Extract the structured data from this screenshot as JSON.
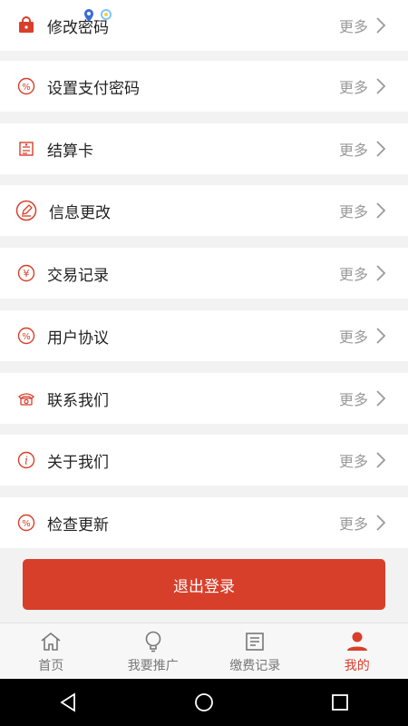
{
  "colors": {
    "accent": "#d83f2a",
    "background": "#f2f2f2",
    "more_text": "#9a9a9a"
  },
  "menu": {
    "items": [
      {
        "label": "修改密码",
        "more": "更多",
        "icon": "shopping-bag-icon"
      },
      {
        "label": "设置支付密码",
        "more": "更多",
        "icon": "percent-circle-icon"
      },
      {
        "label": "结算卡",
        "more": "更多",
        "icon": "card-icon"
      },
      {
        "label": "信息更改",
        "more": "更多",
        "icon": "edit-circle-icon"
      },
      {
        "label": "交易记录",
        "more": "更多",
        "icon": "yen-circle-icon"
      },
      {
        "label": "用户协议",
        "more": "更多",
        "icon": "percent-circle-icon"
      },
      {
        "label": "联系我们",
        "more": "更多",
        "icon": "telephone-icon"
      },
      {
        "label": "关于我们",
        "more": "更多",
        "icon": "info-circle-icon"
      },
      {
        "label": "检查更新",
        "more": "更多",
        "icon": "percent-circle-icon"
      }
    ]
  },
  "logout": {
    "label": "退出登录"
  },
  "tabbar": {
    "tabs": [
      {
        "label": "首页",
        "icon": "home-icon",
        "active": false
      },
      {
        "label": "我要推广",
        "icon": "lightbulb-icon",
        "active": false
      },
      {
        "label": "缴费记录",
        "icon": "notepad-icon",
        "active": false
      },
      {
        "label": "我的",
        "icon": "person-icon",
        "active": true
      }
    ]
  },
  "navbar": {
    "buttons": [
      "back-icon",
      "home-circle-icon",
      "recents-icon"
    ]
  }
}
